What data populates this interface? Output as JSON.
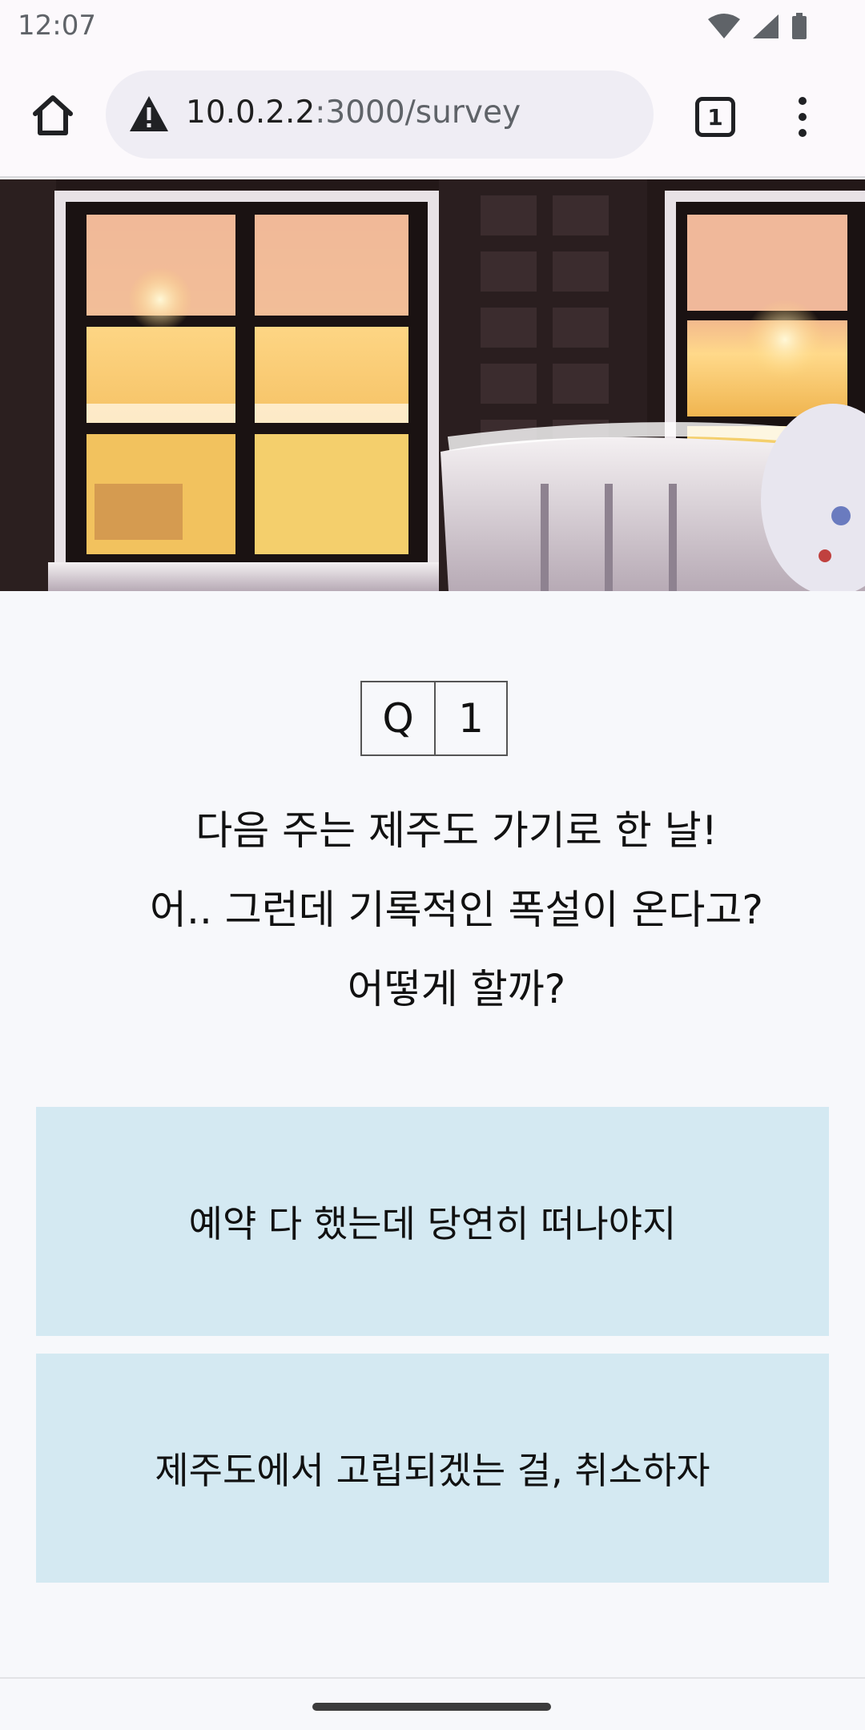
{
  "status_bar": {
    "time": "12:07"
  },
  "browser": {
    "url_host": "10.0.2.2",
    "url_path": ":3000/survey",
    "tab_count": "1"
  },
  "hero": {
    "icon": "snowy-window-photo"
  },
  "survey": {
    "q_prefix": "Q",
    "q_number": "1",
    "question_lines": [
      "다음 주는 제주도 가기로 한 날!",
      "어.. 그런데 기록적인 폭설이 온다고?",
      "어떻게 할까?"
    ],
    "answers": [
      "예약 다 했는데 당연히 떠나야지",
      "제주도에서 고립되겠는 걸, 취소하자"
    ]
  },
  "colors": {
    "answer_bg": "#d4e9f2",
    "page_bg": "#f7f8fb"
  }
}
